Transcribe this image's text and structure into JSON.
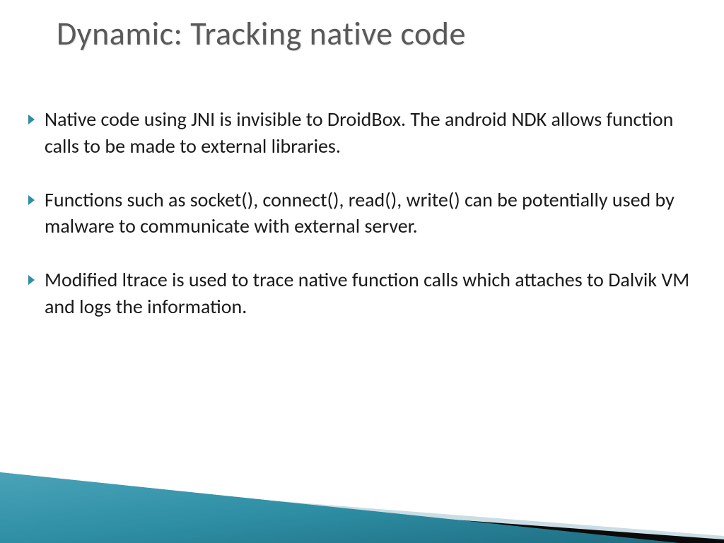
{
  "title": "Dynamic: Tracking native code",
  "bullets": [
    "Native code using JNI is invisible to DroidBox. The android NDK allows function calls to be made to external libraries.",
    "Functions such as socket(), connect(), read(), write() can be potentially used by malware to communicate with external server.",
    "Modified ltrace is used to trace native function calls which attaches to Dalvik VM and logs the information."
  ],
  "theme": {
    "accent": "#2e8ea4",
    "title_color": "#595959",
    "body_color": "#1a1a1a"
  }
}
